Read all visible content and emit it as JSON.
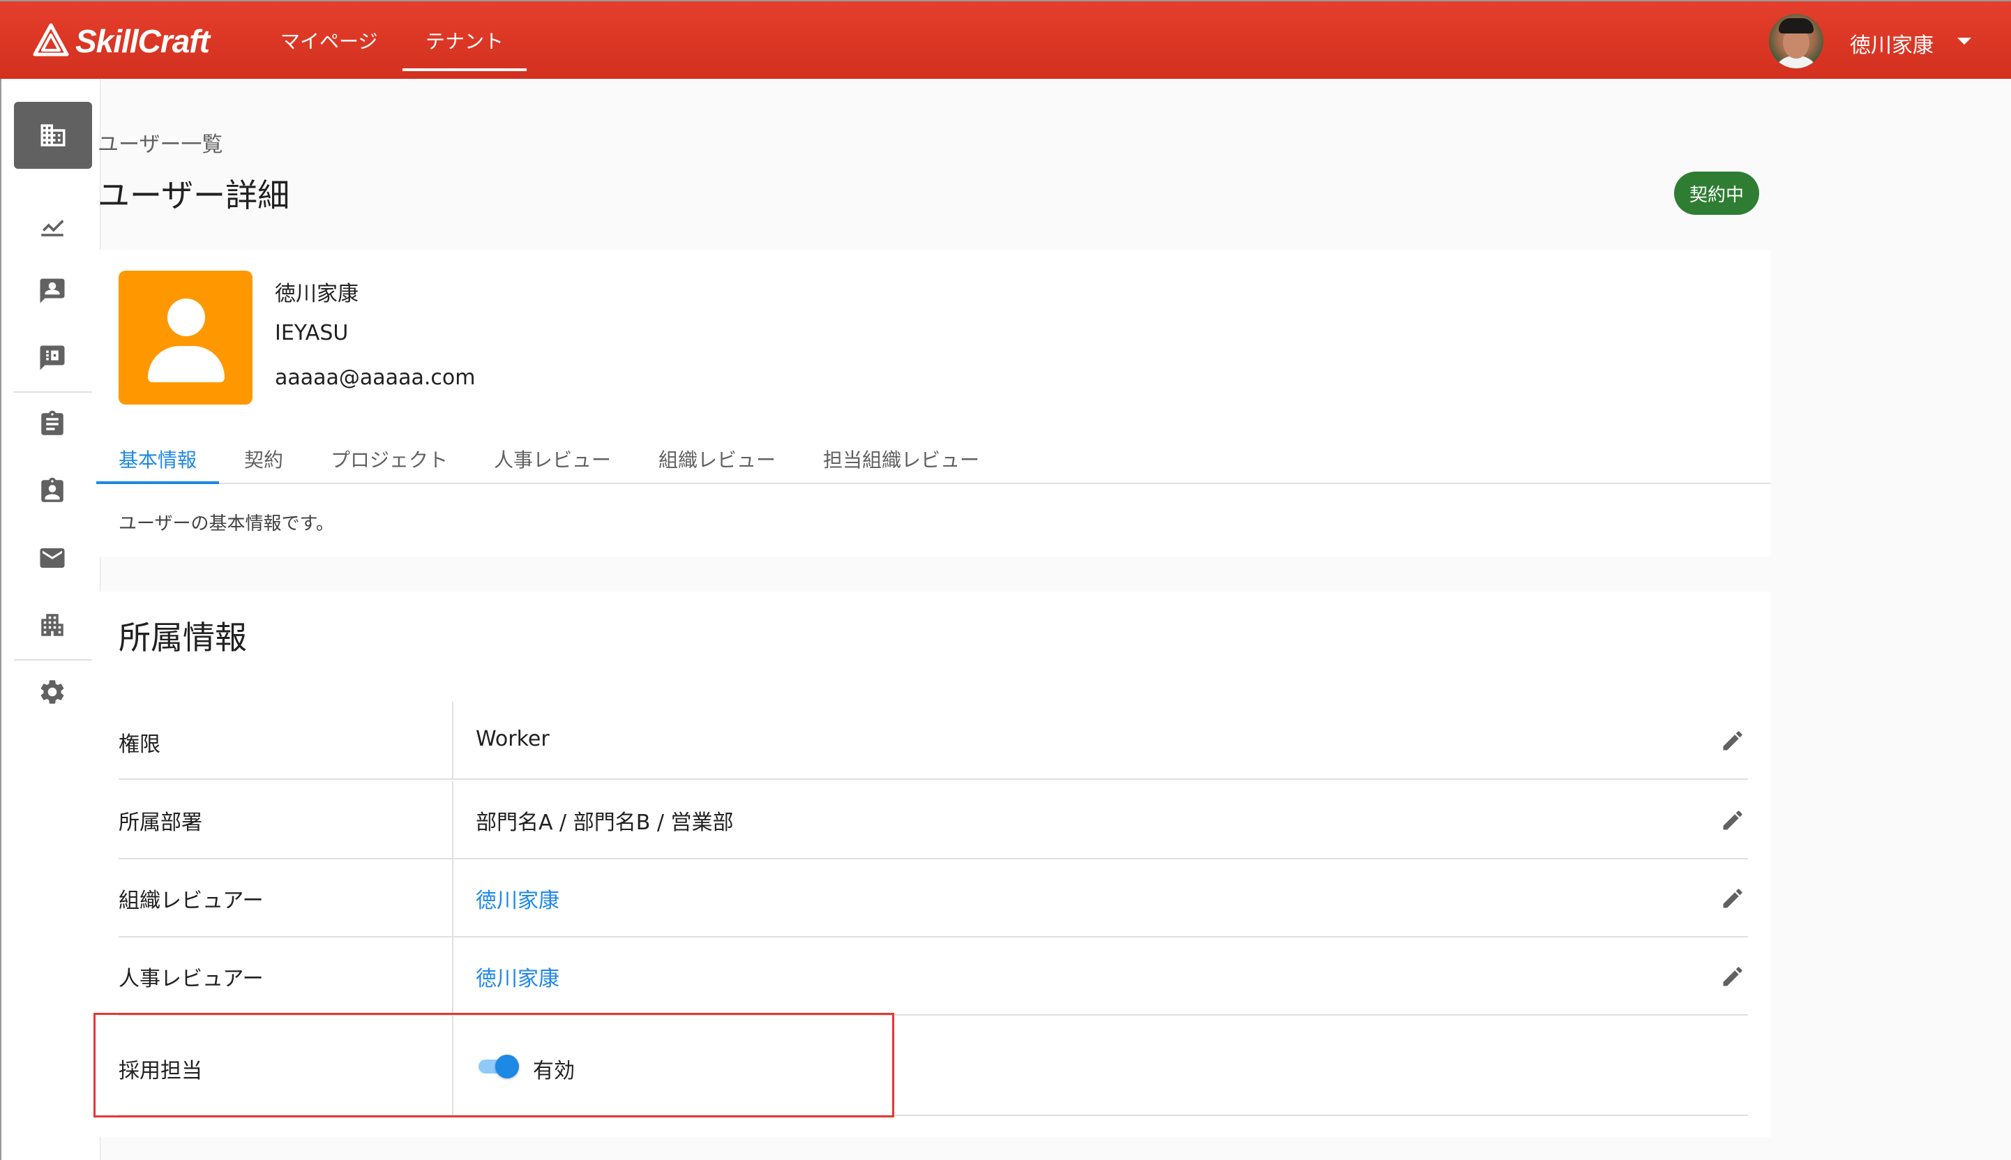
{
  "header": {
    "logo_text": "SkillCraft",
    "nav": [
      {
        "label": "マイページ",
        "active": false
      },
      {
        "label": "テナント",
        "active": true
      }
    ],
    "user_name": "徳川家康"
  },
  "sidebar": {
    "items": [
      {
        "icon": "building-icon",
        "active": true
      },
      {
        "icon": "trending-up-icon",
        "active": false
      },
      {
        "icon": "profile-card-icon",
        "active": false
      },
      {
        "icon": "chat-building-icon",
        "active": false
      },
      {
        "icon": "clipboard-icon",
        "active": false
      },
      {
        "icon": "clipboard-account-icon",
        "active": false
      },
      {
        "icon": "mail-icon",
        "active": false
      },
      {
        "icon": "apartment-icon",
        "active": false
      },
      {
        "icon": "gear-icon",
        "active": false
      }
    ]
  },
  "breadcrumb": "ユーザー一覧",
  "page_title": "ユーザー詳細",
  "status_badge": "契約中",
  "profile": {
    "name": "徳川家康",
    "login_id": "IEYASU",
    "email": "aaaaa@aaaaa.com"
  },
  "tabs": [
    {
      "label": "基本情報",
      "active": true
    },
    {
      "label": "契約",
      "active": false
    },
    {
      "label": "プロジェクト",
      "active": false
    },
    {
      "label": "人事レビュー",
      "active": false
    },
    {
      "label": "組織レビュー",
      "active": false
    },
    {
      "label": "担当組織レビュー",
      "active": false
    }
  ],
  "tab_description": "ユーザーの基本情報です。",
  "affiliation": {
    "title": "所属情報",
    "rows": [
      {
        "label": "権限",
        "value": "Worker",
        "link": false
      },
      {
        "label": "所属部署",
        "value": "部門名A / 部門名B / 営業部",
        "link": false
      },
      {
        "label": "組織レビュアー",
        "value": "徳川家康",
        "link": true
      },
      {
        "label": "人事レビュアー",
        "value": "徳川家康",
        "link": true
      }
    ],
    "recruiter": {
      "label": "採用担当",
      "toggle_on": true,
      "value": "有効"
    }
  },
  "colors": {
    "header": "#d3301f",
    "accent": "#1e88e5",
    "badge": "#2e7d32",
    "profile_bg": "#ff9800",
    "highlight": "#e53935"
  }
}
